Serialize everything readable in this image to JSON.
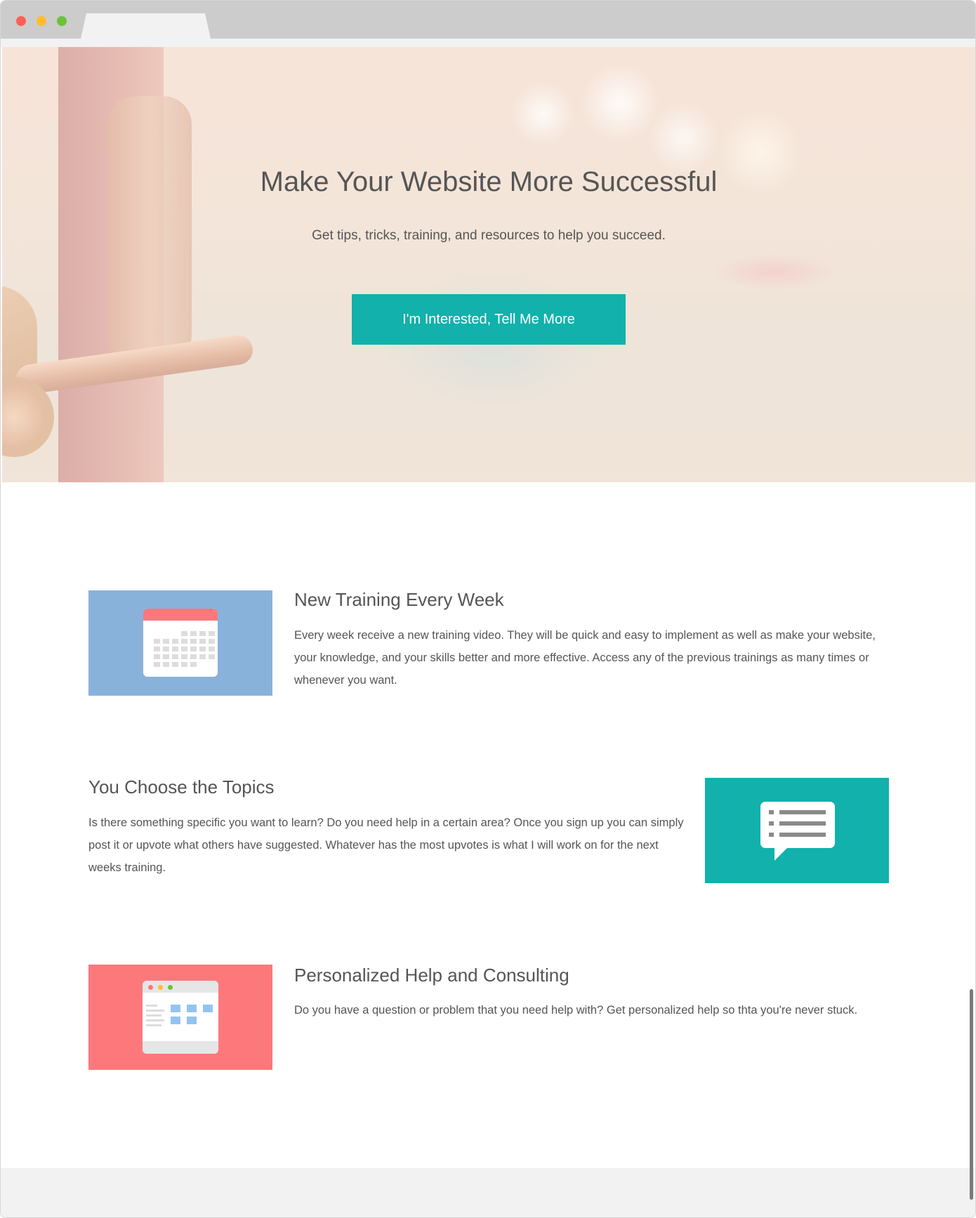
{
  "hero": {
    "title": "Make Your Website More Successful",
    "subtitle": "Get tips, tricks, training, and resources to help you succeed.",
    "cta_label": "I'm Interested, Tell Me More"
  },
  "features": [
    {
      "title": "New Training Every Week",
      "text": "Every week receive a new training video. They will be quick and easy to implement as well as make your website, your knowledge, and your skills better and more effective. Access any of the previous trainings as many times or whenever you want.",
      "icon": "calendar-icon",
      "color": "#89b2db"
    },
    {
      "title": "You Choose the Topics",
      "text": "Is there something specific you want to learn? Do you need help in a certain area? Once you sign up you can simply post it or upvote what others have suggested. Whatever has the most upvotes is what I will work on for the next weeks training.",
      "icon": "chat-icon",
      "color": "#12b1ab"
    },
    {
      "title": "Personalized Help and Consulting",
      "text": "Do you have a question or problem that you need help with? Get personalized help so thta you're never stuck.",
      "icon": "browser-window-icon",
      "color": "#fd787b"
    }
  ],
  "colors": {
    "accent": "#12b1ab",
    "window_dot_red": "#ff5f57",
    "window_dot_yellow": "#ffbd2e",
    "window_dot_green": "#6cc13a"
  }
}
